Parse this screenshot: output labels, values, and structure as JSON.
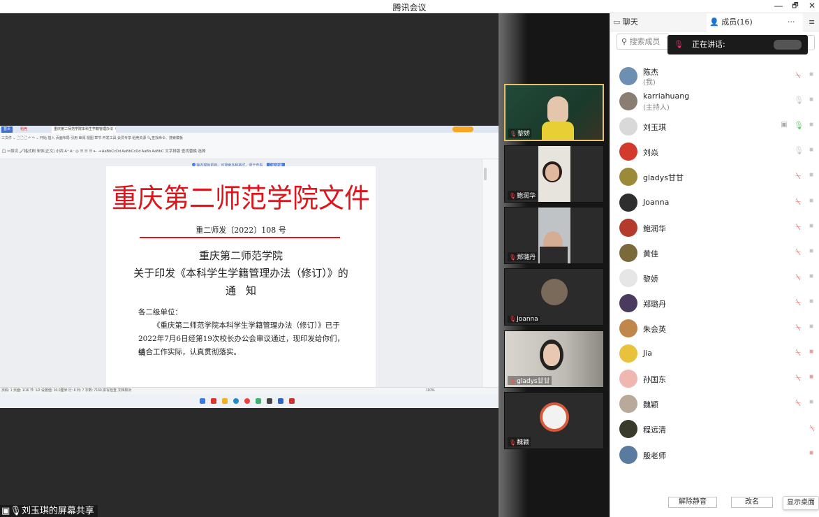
{
  "window": {
    "title": "腾讯会议",
    "controls": [
      "—",
      "🗗",
      "✕"
    ]
  },
  "share": {
    "label": "刘玉琪的屏幕共享",
    "wps": {
      "tabs": [
        "首页",
        "稻壳",
        "重庆第二师范学院本科生学籍管理办法（修订）的通知"
      ],
      "ribbon_row1": "三文件 ⌄  🗋 🗋 🗋 ↶ ↷ ⌄  开始  插入  页面布局  引用  审阅  视图  章节  开发工具  会员专享  稻壳资源   🔍查找命令、搜索模板",
      "ribbon_row2": "📋 ✂剪切 🖌格式刷  宋体(正文) 小四  A⁺ A⁻ ◎  ☰ ☰ ☰ ⇤ ⇥  AaBbCcDd AaBbCcDd AaBb AaBbC  文字排版  查找替换  选择",
      "notice": "静态模板更新。可搜索多种格式，便于查看",
      "notice_btn": "立即更新",
      "status": "页码: 1   页面: 1/16   节: 1/2   设置值: 10.0厘米   行: 8   列: 7   字数: 7169   拼写检查   文档校对",
      "zoom": "110%"
    },
    "document": {
      "header": "重庆第二师范学院文件",
      "number": "重二师发〔2022〕108 号",
      "title_line1": "重庆第二师范学院",
      "title_line2": "关于印发《本科学生学籍管理办法（修订）》的",
      "title_line3": "通知",
      "greeting": "各二级单位：",
      "body_line1": "《重庆第二师范学院本科学生学籍管理办法（修订）》已于",
      "body_line2": "2022年7月6日经第19次校长办公会审议通过，现印发给你们，请",
      "body_line3": "结合工作实际，认真贯彻落实。"
    }
  },
  "videos": [
    {
      "name": "黎娇",
      "active": true
    },
    {
      "name": "鲍润华",
      "active": false
    },
    {
      "name": "郑璐丹",
      "active": false
    },
    {
      "name": "Joanna",
      "active": false
    },
    {
      "name": "gladys甘甘",
      "active": false
    },
    {
      "name": "魏颖",
      "active": false
    }
  ],
  "panel": {
    "tab_chat": "聊天",
    "tab_members": "成员(16)",
    "more": "···",
    "menu": "≡",
    "search_placeholder": "搜索成员",
    "speaking_label": "正在讲话:",
    "members": [
      {
        "name": "陈杰",
        "role": "(我)",
        "mic": "muted",
        "cam": "off",
        "color": "#6d8fb1"
      },
      {
        "name": "karriahuang",
        "role": "(主持人)",
        "mic": "on",
        "cam": "off",
        "color": "#8a7d72"
      },
      {
        "name": "刘玉琪",
        "role": "",
        "mic": "green",
        "cam": "off",
        "screen": true,
        "color": "#d9d9d9"
      },
      {
        "name": "刘焱",
        "role": "",
        "mic": "on",
        "cam": "off",
        "color": "#d23a2c"
      },
      {
        "name": "gladys甘甘",
        "role": "",
        "mic": "muted",
        "cam": "off",
        "color": "#9a8a3a"
      },
      {
        "name": "Joanna",
        "role": "",
        "mic": "muted",
        "cam": "off",
        "color": "#2e2e2e"
      },
      {
        "name": "鲍润华",
        "role": "",
        "mic": "muted",
        "cam": "off",
        "color": "#b43a2d"
      },
      {
        "name": "黄佳",
        "role": "",
        "mic": "muted",
        "cam": "off",
        "color": "#7a6a3a"
      },
      {
        "name": "黎娇",
        "role": "",
        "mic": "muted",
        "cam": "off",
        "color": "#e6e6e6"
      },
      {
        "name": "郑璐丹",
        "role": "",
        "mic": "muted",
        "cam": "off",
        "color": "#4a3a5e"
      },
      {
        "name": "朱会英",
        "role": "",
        "mic": "muted",
        "cam": "off",
        "color": "#c1874a"
      },
      {
        "name": "Jia",
        "role": "",
        "mic": "muted",
        "cam": "off-red",
        "color": "#e8c23a"
      },
      {
        "name": "孙国东",
        "role": "",
        "mic": "muted",
        "cam": "off-red",
        "color": "#f0b7b0"
      },
      {
        "name": "魏颖",
        "role": "",
        "mic": "muted",
        "cam": "off",
        "color": "#b9a99a"
      },
      {
        "name": "程远清",
        "role": "",
        "mic": "muted",
        "cam": "none",
        "color": "#3a3a2a"
      },
      {
        "name": "殷老师",
        "role": "",
        "mic": "none",
        "cam": "off-red",
        "color": "#5a7ba0"
      }
    ],
    "btn_unmute": "解除静音",
    "btn_rename": "改名",
    "btn_desktop": "显示桌面"
  }
}
